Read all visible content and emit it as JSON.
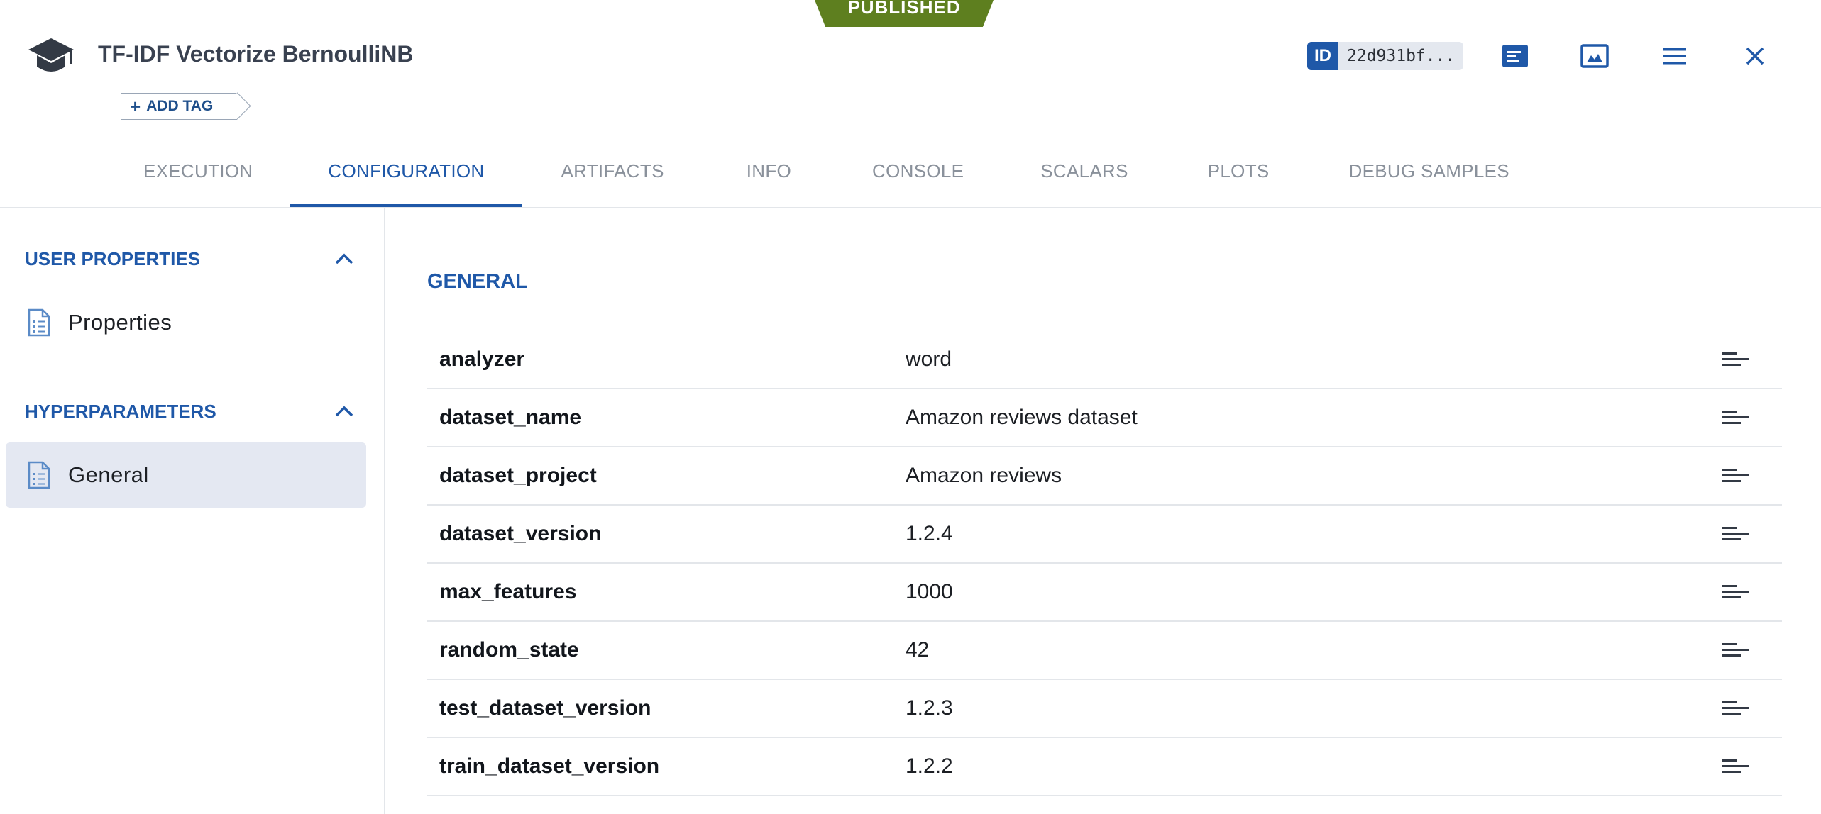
{
  "status_badge": "PUBLISHED",
  "task": {
    "title": "TF-IDF Vectorize BernoulliNB",
    "add_tag_label": "ADD TAG",
    "id_label": "ID",
    "id_value": "22d931bf..."
  },
  "header_icons": [
    "graduation-cap-icon",
    "id-badge",
    "console-panel-icon",
    "image-icon",
    "menu-icon",
    "close-icon"
  ],
  "tabs": [
    {
      "label": "EXECUTION"
    },
    {
      "label": "CONFIGURATION",
      "active": true
    },
    {
      "label": "ARTIFACTS"
    },
    {
      "label": "INFO"
    },
    {
      "label": "CONSOLE"
    },
    {
      "label": "SCALARS"
    },
    {
      "label": "PLOTS"
    },
    {
      "label": "DEBUG SAMPLES"
    }
  ],
  "sidebar": {
    "sections": [
      {
        "title": "USER PROPERTIES",
        "items": [
          {
            "label": "Properties"
          }
        ]
      },
      {
        "title": "HYPERPARAMETERS",
        "items": [
          {
            "label": "General",
            "selected": true
          }
        ]
      }
    ]
  },
  "main": {
    "section_title": "GENERAL",
    "params": [
      {
        "name": "analyzer",
        "value": "word"
      },
      {
        "name": "dataset_name",
        "value": "Amazon reviews dataset"
      },
      {
        "name": "dataset_project",
        "value": "Amazon reviews"
      },
      {
        "name": "dataset_version",
        "value": "1.2.4"
      },
      {
        "name": "max_features",
        "value": "1000"
      },
      {
        "name": "random_state",
        "value": "42"
      },
      {
        "name": "test_dataset_version",
        "value": "1.2.3"
      },
      {
        "name": "train_dataset_version",
        "value": "1.2.2"
      }
    ]
  },
  "colors": {
    "accent": "#1f58a8",
    "published": "#5e7f1f"
  }
}
